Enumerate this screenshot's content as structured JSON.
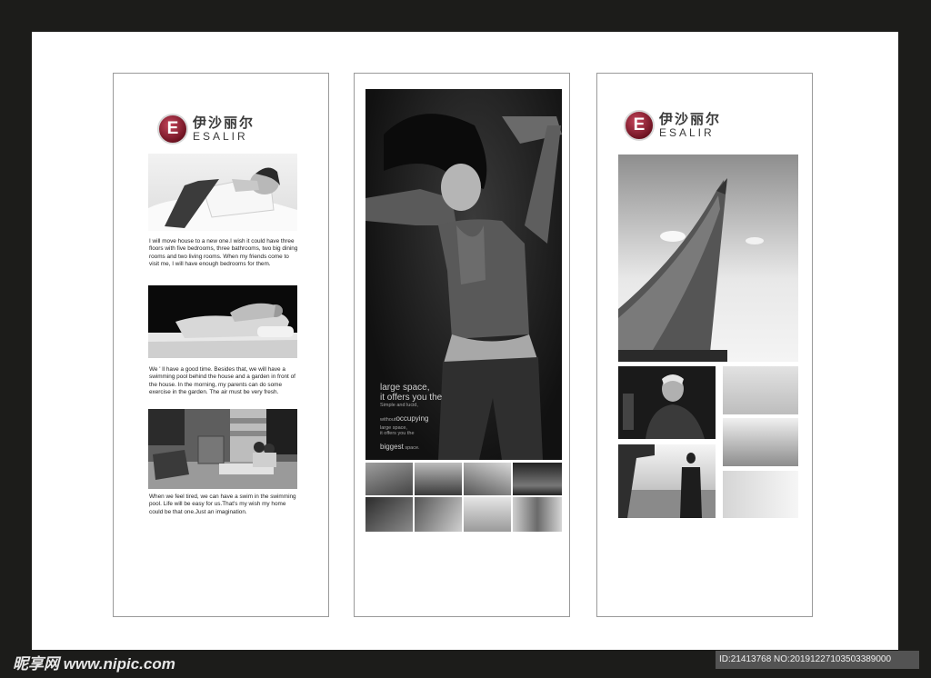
{
  "logo": {
    "mark": "E",
    "cn": "伊沙丽尔",
    "en": "ESALIR"
  },
  "left_panel": {
    "paragraphs": [
      " I will move house to a new one.I wish it could have three floors with five bedrooms, three bathrooms, two big dining rooms and two living rooms. When my friends come to visit me, I will have enough bedrooms for them.",
      "We ' ll have a good time. Besides that, we  will have a swimming pool behind the house and a garden in front of the house. In the morning, my parents can do some exercise in the garden. The air must be very fresh.",
      "When we feel tired, we can have a swim in the swimming pool. Life will be easy for us.That's my wish my home could be that one.Just an imagination."
    ]
  },
  "middle_panel": {
    "overlay": {
      "line1": "large space,",
      "line2": "it offers you the",
      "small1": "Simple and lucid,",
      "mid_prefix": "without",
      "mid_big": "occupying",
      "small2": "large space,",
      "small3": "it offers you the",
      "last_big": "biggest",
      "last_small": " space."
    }
  },
  "watermarks": {
    "left": "昵享网 www.nipic.com",
    "right": "ID:21413768 NO:20191227103503389000"
  }
}
